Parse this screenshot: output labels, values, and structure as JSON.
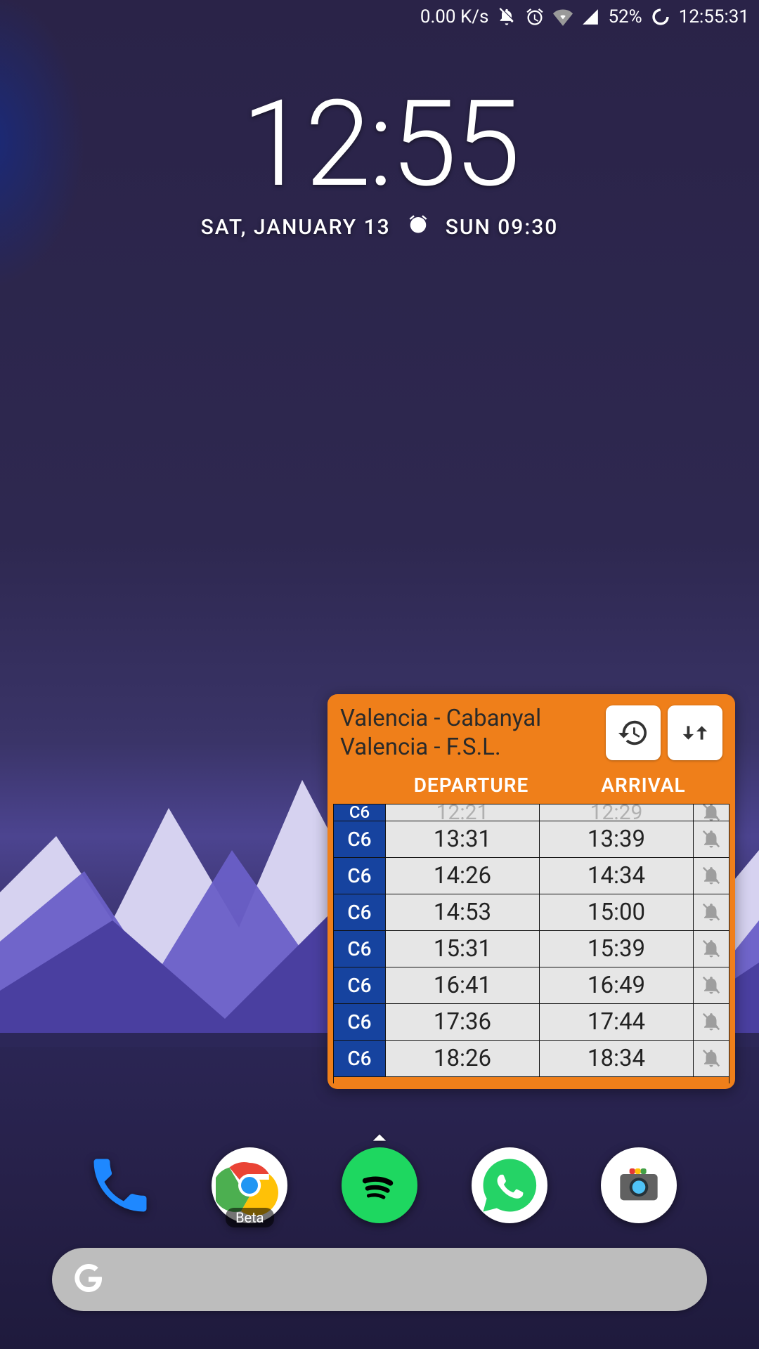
{
  "statusbar": {
    "net_speed": "0.00 K/s",
    "battery_pct": "52%",
    "time": "12:55:31"
  },
  "clock": {
    "time": "12:55",
    "date": "SAT, JANUARY 13",
    "alarm": "SUN 09:30"
  },
  "train": {
    "origin": "Valencia - Cabanyal",
    "destination": "Valencia - F.S.L.",
    "col_departure": "DEPARTURE",
    "col_arrival": "ARRIVAL",
    "rows": [
      {
        "line": "C6",
        "departure": "12:21",
        "arrival": "12:29",
        "past": true
      },
      {
        "line": "C6",
        "departure": "13:31",
        "arrival": "13:39",
        "past": false
      },
      {
        "line": "C6",
        "departure": "14:26",
        "arrival": "14:34",
        "past": false
      },
      {
        "line": "C6",
        "departure": "14:53",
        "arrival": "15:00",
        "past": false
      },
      {
        "line": "C6",
        "departure": "15:31",
        "arrival": "15:39",
        "past": false
      },
      {
        "line": "C6",
        "departure": "16:41",
        "arrival": "16:49",
        "past": false
      },
      {
        "line": "C6",
        "departure": "17:36",
        "arrival": "17:44",
        "past": false
      },
      {
        "line": "C6",
        "departure": "18:26",
        "arrival": "18:34",
        "past": false
      }
    ]
  },
  "dock": {
    "chrome_badge": "Beta"
  }
}
